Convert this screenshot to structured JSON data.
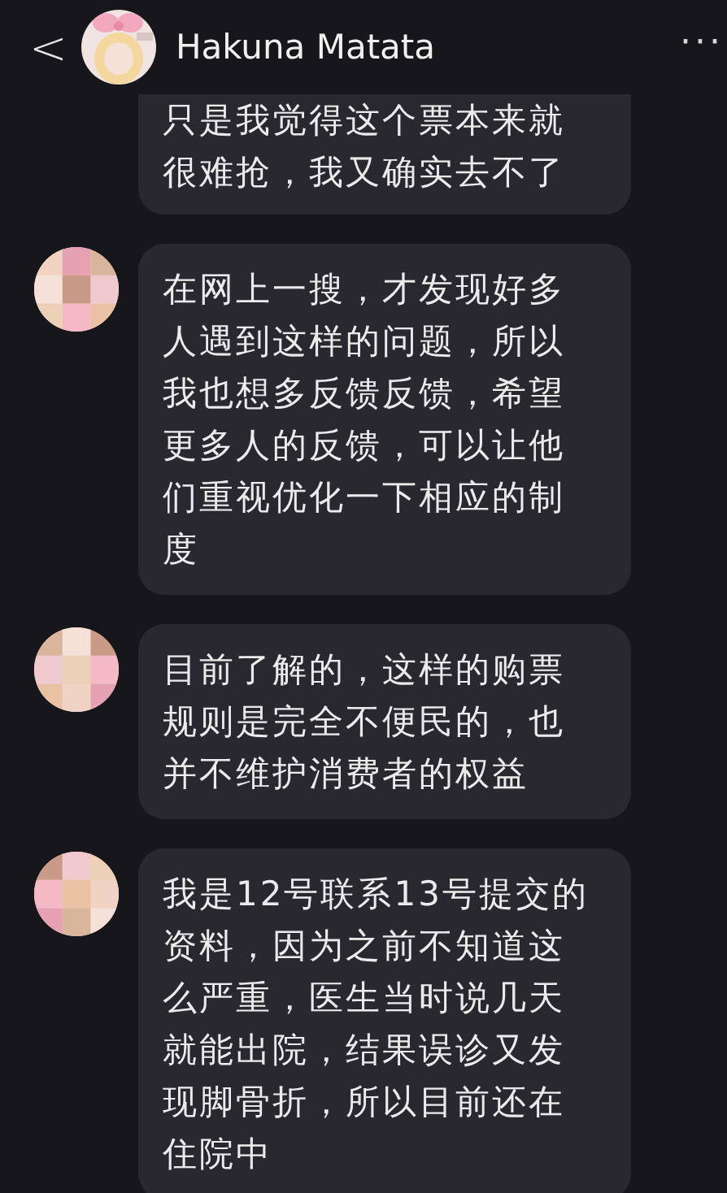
{
  "header": {
    "back": "<",
    "title": "Hakuna Matata",
    "more": "···"
  },
  "messages": [
    {
      "lines": [
        "只是我觉得这个票本来就",
        "很难抢，我又确实去不了"
      ]
    },
    {
      "avatar": {
        "kind": "picture"
      },
      "lines": [
        "在网上一搜，才发现好多",
        "人遇到这样的问题，所以",
        "我也想多反馈反馈，希望",
        "更多人的反馈，可以让他",
        "们重视优化一下相应的制",
        "度"
      ]
    },
    {
      "avatar": {
        "kind": "picture"
      },
      "lines": [
        "目前了解的，这样的购票",
        "规则是完全不便民的，也",
        "并不维护消费者的权益"
      ]
    },
    {
      "avatar": {
        "kind": "picture"
      },
      "lines": [
        "我是12号联系13号提交的",
        "资料，因为之前不知道这",
        "么严重，医生当时说几天",
        "就能出院，结果误诊又发",
        "现脚骨折，所以目前还在",
        "住院中"
      ]
    }
  ]
}
